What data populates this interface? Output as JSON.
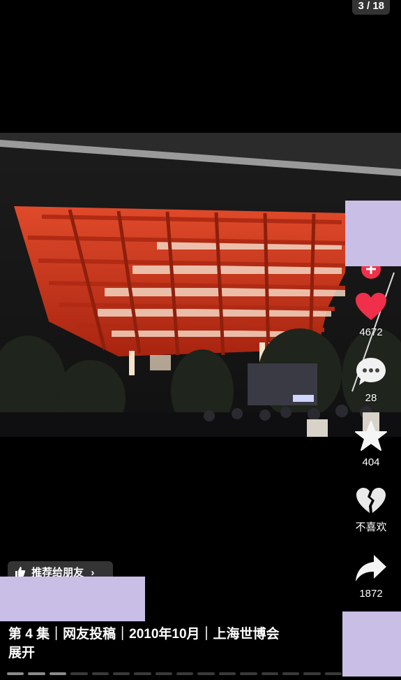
{
  "page_counter": "3 / 18",
  "actions": {
    "like_count": "4672",
    "comment_count": "28",
    "favorite_count": "404",
    "dislike_label": "不喜欢",
    "share_count": "1872"
  },
  "recommend": {
    "label": "推荐给朋友",
    "chevron": "›"
  },
  "caption": {
    "text": "第 4 集｜网友投稿｜2010年10月｜上海世博会",
    "expand_label": "展开"
  },
  "progress": {
    "total_segments": 16,
    "completed_segments": 3
  },
  "colors": {
    "like": "#f0304a",
    "follow_badge": "#f0304a",
    "mask": "#c9bfe6",
    "pavilion_red": "#c9341c"
  },
  "icons": {
    "like": "heart-icon",
    "comment": "comment-bubble-icon",
    "favorite": "star-icon",
    "dislike": "broken-heart-icon",
    "share": "share-arrow-icon",
    "recommend": "thumbs-up-icon"
  }
}
